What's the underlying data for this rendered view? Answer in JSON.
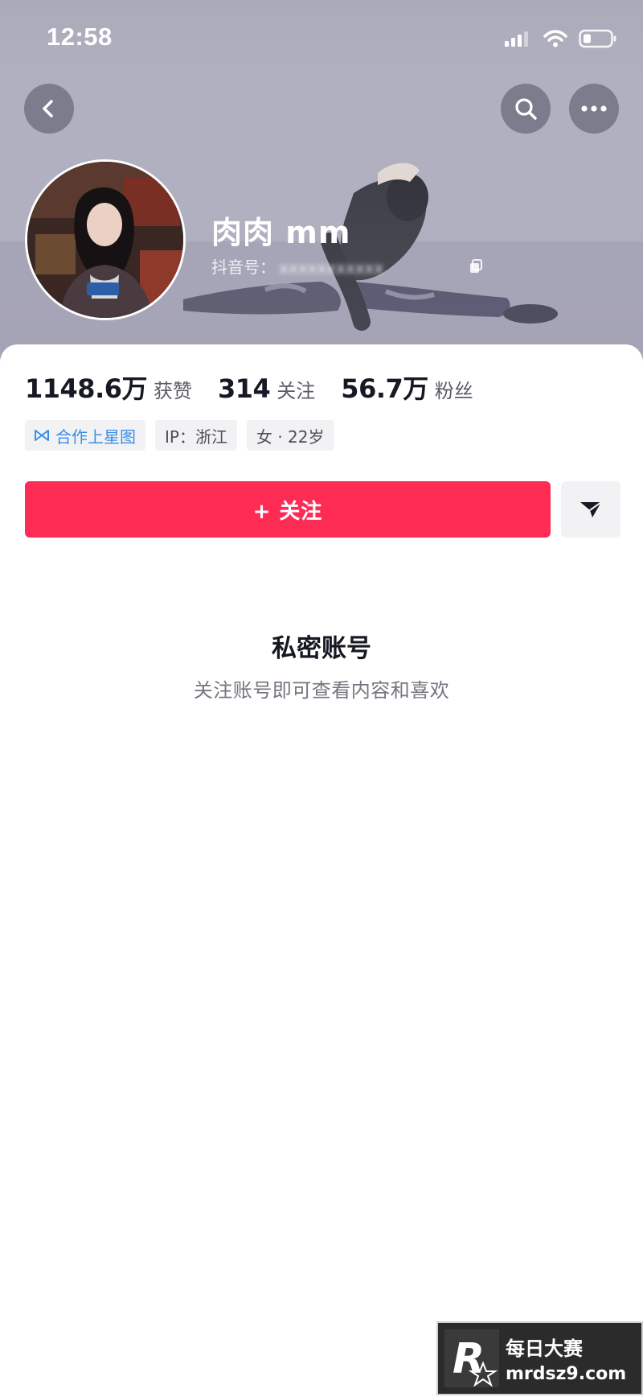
{
  "status_bar": {
    "time": "12:58"
  },
  "header": {
    "back_icon": "chevron-left-icon",
    "search_icon": "search-icon",
    "more_icon": "more-horizontal-icon"
  },
  "profile": {
    "nickname": "肉肉 mm",
    "douyin_id_label": "抖音号：",
    "douyin_id_value": "xxxxxxxxxxx"
  },
  "stats": [
    {
      "value": "1148.6万",
      "label": "获赞"
    },
    {
      "value": "314",
      "label": "关注"
    },
    {
      "value": "56.7万",
      "label": "粉丝"
    }
  ],
  "tags": {
    "star_map": "合作上星图",
    "ip": "IP：浙江",
    "gender_age": "女 · 22岁"
  },
  "actions": {
    "follow_label": "+ 关注",
    "share_icon": "send-icon"
  },
  "private_notice": {
    "title": "私密账号",
    "subtitle": "关注账号即可查看内容和喜欢"
  },
  "watermark": {
    "logo_letter": "R",
    "brand": "每日大赛",
    "site": "mrdsz9.com"
  },
  "colors": {
    "accent": "#fe2c55",
    "star_tag": "#3a8ee6",
    "text_primary": "#161823",
    "text_secondary": "#74757e"
  }
}
